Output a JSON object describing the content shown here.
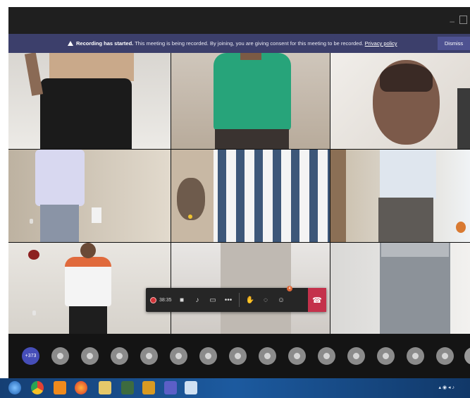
{
  "window": {
    "minimize_glyph": "–"
  },
  "banner": {
    "title": "Recording has started.",
    "message": " This meeting is being recorded. By joining, you are giving consent for this meeting to be recorded. ",
    "privacy_link": "Privacy policy",
    "dismiss_label": "Dismiss"
  },
  "controls": {
    "timer": "38:35",
    "participants_badge": "4"
  },
  "roster": {
    "overflow_count": "+373"
  },
  "colors": {
    "banner_bg": "#3c3f6b",
    "hangup": "#c4314b",
    "overflow_badge": "#464eb8",
    "record_dot": "#d13438"
  }
}
